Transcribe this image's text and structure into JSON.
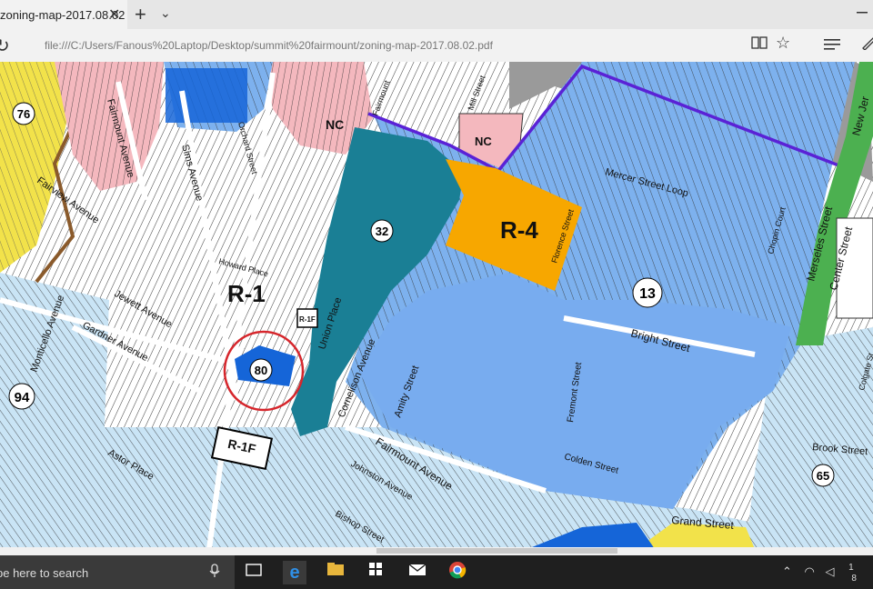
{
  "browser": {
    "tab_title": "zoning-map-2017.08.02",
    "tab_close": "✕",
    "new_tab": "+",
    "tab_menu": "⌄",
    "url": "file:///C:/Users/Fanous%20Laptop/Desktop/summit%20fairmount/zoning-map-2017.08.02.pdf"
  },
  "map": {
    "zones": {
      "r1": "R-1",
      "r4": "R-4",
      "nc1": "NC",
      "nc2": "NC",
      "r1f_a": "R-1F",
      "r1f_b": "R-1F"
    },
    "circles": [
      "76",
      "32",
      "13",
      "80",
      "94",
      "65"
    ],
    "streets": {
      "fairmount_top": "Fairmount Avenue",
      "fairview": "Fairview Avenue",
      "sims": "Sims Avenue",
      "orchard": "Orchard Street",
      "howard": "Howard Place",
      "jewett": "Jewett Avenue",
      "monticello": "Monticello Avenue",
      "gardner": "Gardner Avenue",
      "astor": "Astor Place",
      "cornelison": "Cornelison Avenue",
      "union": "Union Place",
      "mercer": "Mercer Street Loop",
      "chopin": "Chopin Court",
      "florence": "Florence Street",
      "bright": "Bright Street",
      "amity": "Amity Street",
      "fremont": "Fremont Street",
      "colden": "Colden Street",
      "fairmount_bottom": "Fairmount Avenue",
      "johnston": "Johnston Avenue",
      "bishop": "Bishop Street",
      "grand": "Grand Street",
      "brook": "Brook Street",
      "colgate": "Colgate St",
      "merseles": "Merseles Street",
      "center": "Center Street",
      "newjersey": "New Jer",
      "mill": "Mill Street",
      "fairmount_n": "Fairmount"
    }
  },
  "taskbar": {
    "search_text": "pe here to search",
    "tray_time": "1",
    "tray_date": "8"
  }
}
